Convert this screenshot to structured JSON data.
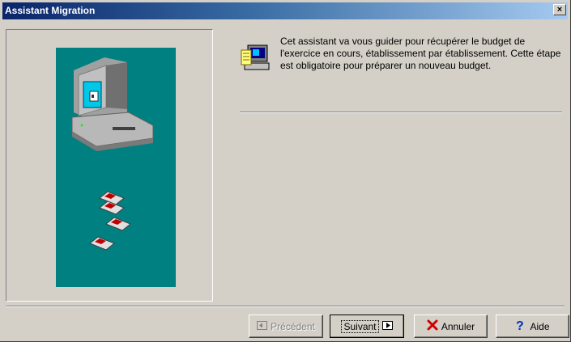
{
  "window": {
    "title": "Assistant Migration",
    "close_glyph": "×"
  },
  "content": {
    "message": "Cet assistant va vous guider pour récupérer le budget de l'exercice en cours, établissement par établissement. Cette étape est obligatoire pour préparer un nouveau budget."
  },
  "buttons": {
    "previous": "Précédent",
    "next": "Suivant",
    "cancel": "Annuler",
    "help": "Aide"
  },
  "colors": {
    "teal": "#008080",
    "title_start": "#0a246a",
    "title_end": "#a6caf0"
  },
  "icons": [
    "computer-icon",
    "floppy-disk-icon",
    "wizard-icon",
    "close-icon",
    "arrow-left-icon",
    "arrow-right-icon",
    "cancel-x-icon",
    "help-question-icon"
  ]
}
